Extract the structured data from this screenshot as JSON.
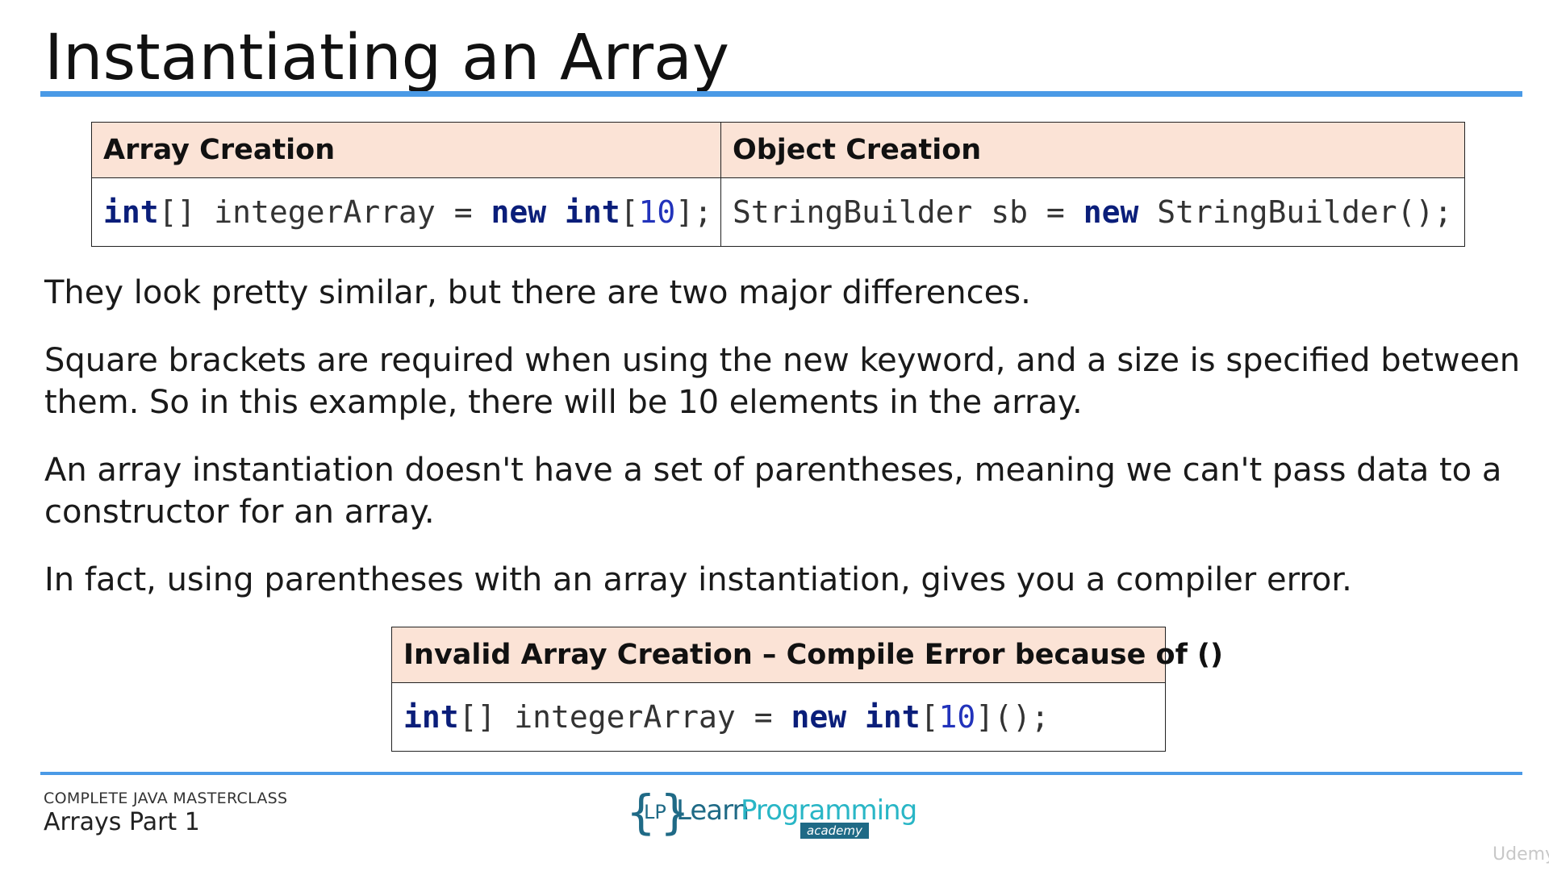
{
  "slide": {
    "title": "Instantiating an Array"
  },
  "top_table": {
    "headers": [
      "Array Creation",
      "Object Creation"
    ],
    "array_creation": {
      "kw1": "int",
      "t1": "[] integerArray = ",
      "kw2": "new",
      "sp": " ",
      "kw3": "int",
      "t2": "[",
      "num": "10",
      "t3": "];"
    },
    "object_creation": {
      "t1": "StringBuilder sb = ",
      "kw1": "new",
      "t2": " StringBuilder();"
    }
  },
  "paragraphs": [
    "They look pretty similar, but there are two major differences.",
    "Square brackets are required when using the new keyword, and a size is specified between them.  So in this example, there will be 10 elements in the array.",
    "An array instantiation doesn't have a set of parentheses, meaning we can't pass data to a constructor for an array.",
    "In fact, using parentheses with an array instantiation, gives you a compiler error."
  ],
  "bottom_table": {
    "header": "Invalid Array Creation – Compile Error because of ()",
    "code": {
      "kw1": "int",
      "t1": "[] integerArray = ",
      "kw2": "new",
      "sp": " ",
      "kw3": "int",
      "t2": "[",
      "num": "10",
      "t3": "]();"
    }
  },
  "footer": {
    "course": "COMPLETE JAVA MASTERCLASS",
    "lesson": "Arrays Part 1",
    "logo": {
      "brace_open": "{",
      "lp": "LP",
      "brace_close": "}",
      "learn": "Learn",
      "programming": "Programming",
      "academy": "academy"
    },
    "watermark": "Udemy"
  },
  "colors": {
    "accent_rule": "#4a9ae6",
    "header_fill": "#fbe3d6",
    "keyword": "#0a1e7a",
    "number": "#2233bb"
  }
}
